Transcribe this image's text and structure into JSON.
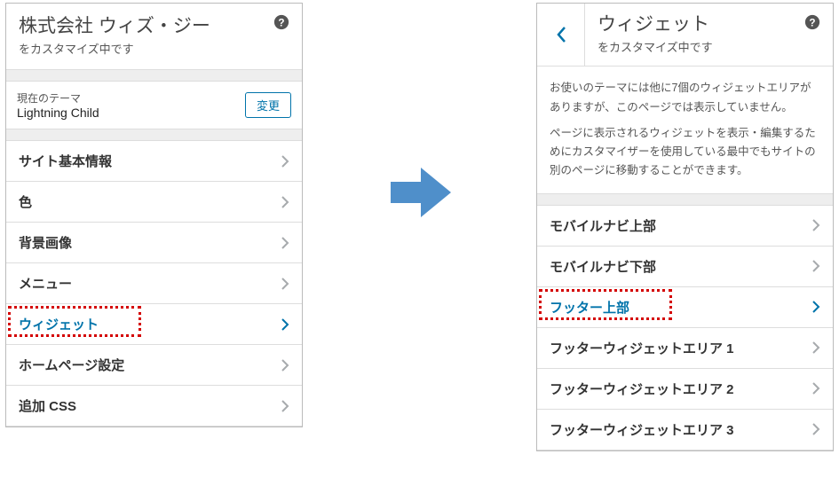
{
  "left": {
    "title": "株式会社 ウィズ・ジー",
    "subtitle": "をカスタマイズ中です",
    "theme_label": "現在のテーマ",
    "theme_name": "Lightning Child",
    "change_btn": "変更",
    "items": [
      {
        "label": "サイト基本情報"
      },
      {
        "label": "色"
      },
      {
        "label": "背景画像"
      },
      {
        "label": "メニュー"
      },
      {
        "label": "ウィジェット",
        "selected": true
      },
      {
        "label": "ホームページ設定"
      },
      {
        "label": "追加 CSS"
      }
    ]
  },
  "right": {
    "title": "ウィジェット",
    "subtitle": "をカスタマイズ中です",
    "desc1": "お使いのテーマには他に7個のウィジェットエリアがありますが、このページでは表示していません。",
    "desc2": "ページに表示されるウィジェットを表示・編集するためにカスタマイザーを使用している最中でもサイトの別のページに移動することができます。",
    "items": [
      {
        "label": "モバイルナビ上部"
      },
      {
        "label": "モバイルナビ下部"
      },
      {
        "label": "フッター上部",
        "selected": true
      },
      {
        "label": "フッターウィジェットエリア 1"
      },
      {
        "label": "フッターウィジェットエリア 2"
      },
      {
        "label": "フッターウィジェットエリア 3"
      }
    ]
  }
}
